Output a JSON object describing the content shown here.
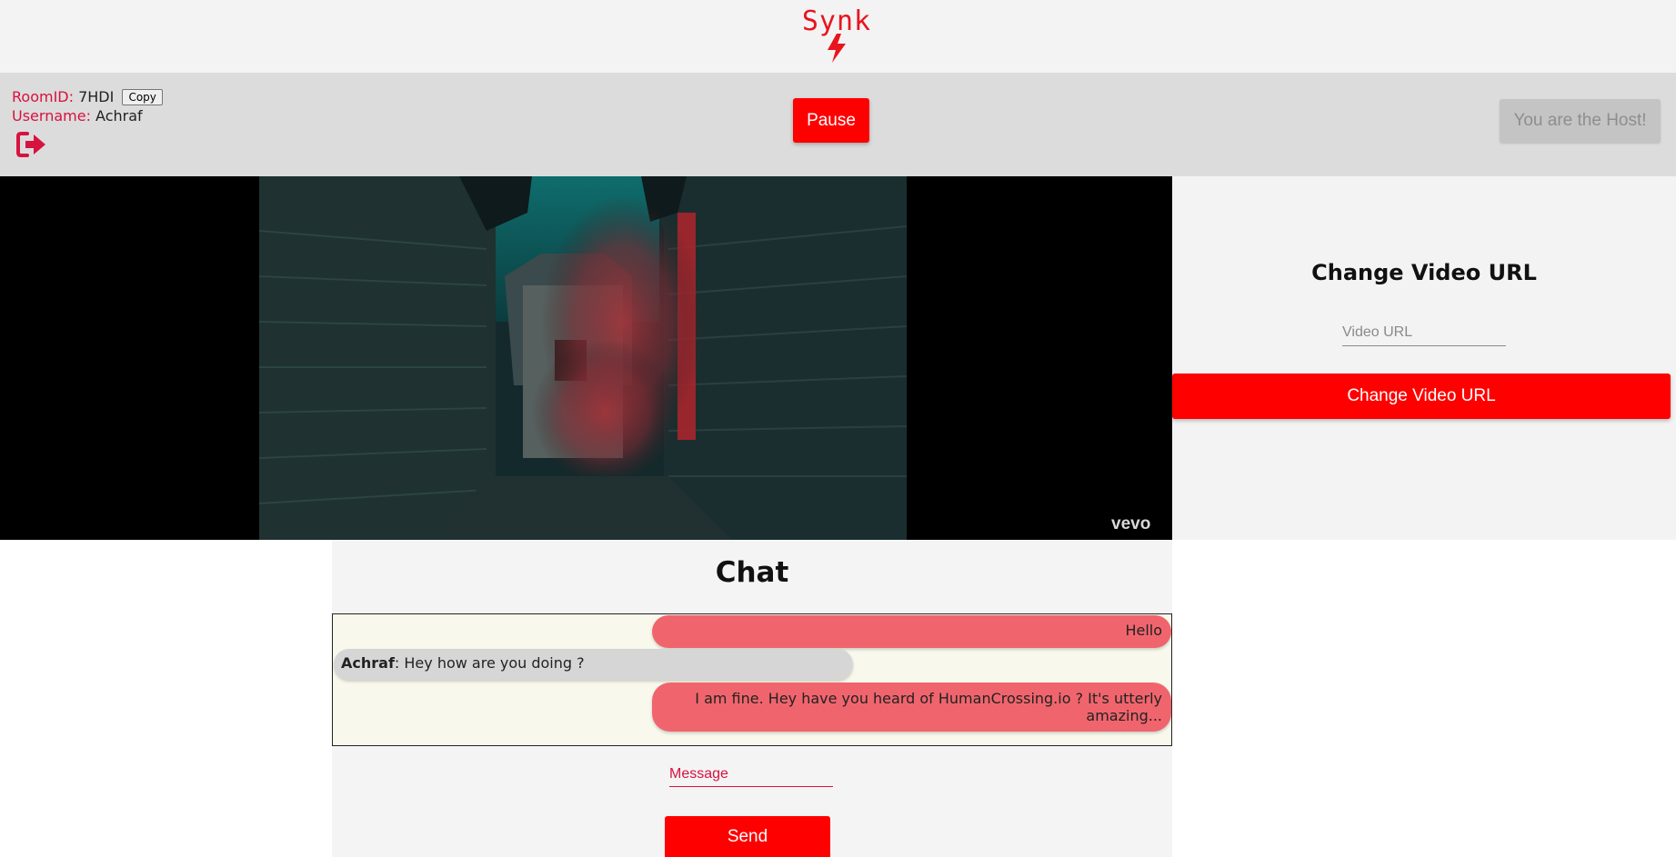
{
  "brand": {
    "name": "Synk",
    "accent": "#ff0000",
    "label_color": "#d7123f"
  },
  "room": {
    "room_label": "RoomID:",
    "room_id": "7HDI",
    "copy_label": "Copy",
    "username_label": "Username:",
    "username": "Achraf",
    "exit_icon": "sign-out-icon"
  },
  "controls": {
    "pause_label": "Pause",
    "host_label": "You are the Host!"
  },
  "video": {
    "watermark": "vevo"
  },
  "change_video": {
    "title": "Change Video URL",
    "input_placeholder": "Video URL",
    "input_value": "",
    "button_label": "Change Video URL"
  },
  "chat": {
    "title": "Chat",
    "messages": [
      {
        "mine": true,
        "sender": "",
        "text": "Hello"
      },
      {
        "mine": false,
        "sender": "Achraf",
        "text": ": Hey how are you doing ?"
      },
      {
        "mine": true,
        "sender": "",
        "text": "I am fine. Hey have you heard of HumanCrossing.io ? It's utterly amazing..."
      }
    ],
    "message_placeholder": "Message",
    "message_value": "",
    "send_label": "Send"
  }
}
